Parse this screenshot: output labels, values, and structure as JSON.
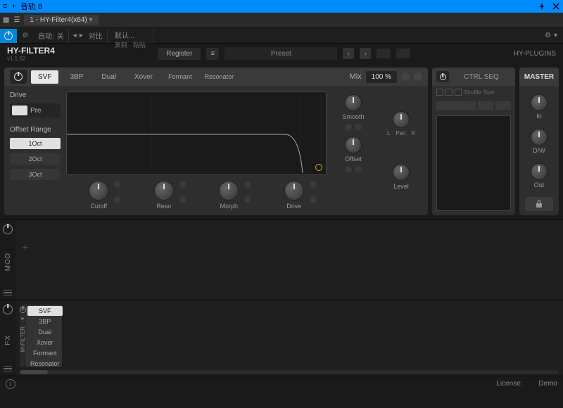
{
  "titlebar": {
    "title": "音轨 8"
  },
  "menubar": {
    "tab": "1 - HY-Filter4(x64)"
  },
  "toolbar": {
    "auto": "自动:",
    "off": "关",
    "compare": "对比",
    "default": "默认...",
    "copy": "复制",
    "paste": "粘贴"
  },
  "header": {
    "title": "HY-FILTER4",
    "version": "v1.1.62",
    "register": "Register",
    "preset": "Preset",
    "brand": "HY-PLUGINS"
  },
  "filter": {
    "tabs": [
      "SVF",
      "3BP",
      "Dual",
      "Xover",
      "Formant",
      "Resonator"
    ],
    "active_tab": 0,
    "mix_label": "Mix",
    "mix_value": "100 %",
    "drive_label": "Drive",
    "pre_label": "Pre",
    "offset_label": "Offset Range",
    "oct_options": [
      "1Oct",
      "2Oct",
      "3Oct"
    ],
    "oct_active": 0,
    "knobs": [
      "Cutoff",
      "Reso",
      "Morph",
      "Drive"
    ],
    "right_knobs": [
      "Smooth",
      "Offset"
    ],
    "outer_knobs": [
      "Pan",
      "Level"
    ],
    "pan_l": "L",
    "pan_r": "R"
  },
  "ctrlseq": {
    "title": "CTRL SEQ",
    "shuffle": "Shuffle",
    "size": "Size"
  },
  "master": {
    "title": "MASTER",
    "knobs": [
      "In",
      "D/W",
      "Out"
    ]
  },
  "mod": {
    "label": "MOD"
  },
  "fx": {
    "label": "FX",
    "module_label": "M-FILTER",
    "items": [
      "SVF",
      "3BP",
      "Dual",
      "Xover",
      "Formant",
      "Resonator"
    ],
    "active": 0
  },
  "footer": {
    "license_label": "License:",
    "license_value": "Demo"
  }
}
